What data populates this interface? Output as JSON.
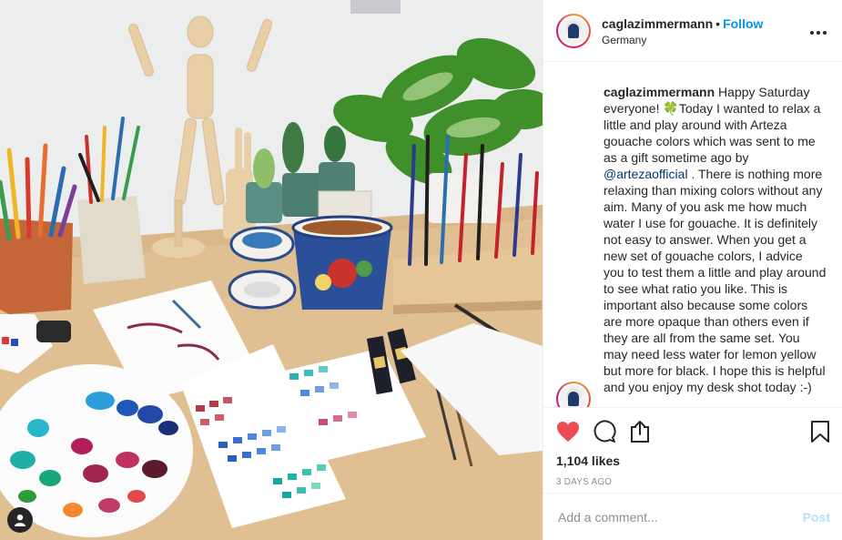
{
  "post": {
    "username": "caglazimmermann",
    "separator": "•",
    "follow_label": "Follow",
    "location": "Germany",
    "more_icon": "more-options-icon",
    "caption": {
      "username": "caglazimmermann",
      "text_before_emoji": " Happy Saturday everyone! ",
      "emoji": "🍀",
      "text_before_mention": "Today I wanted to relax a little and play around with Arteza gouache colors which was sent to me as a gift sometime ago by ",
      "mention": "@artezaofficial",
      "text_after_mention": " . There is nothing more relaxing than mixing colors without any aim. Many of you ask me how much water I use for gouache. It is definitely not easy to answer. When you get a new set of gouache colors, I advice you to test them a little and play around to see what ratio you like. This is important also because some colors are more opaque than others even if they are all from the same set. You may need less water for lemon yellow but more for black. I hope this is helpful and you enjoy my desk shot today :-)"
    },
    "likes": "1,104 likes",
    "timestamp": "3 DAYS AGO",
    "comment_placeholder": "Add a comment...",
    "post_label": "Post",
    "colors": {
      "like_red": "#ed4956",
      "follow_blue": "#0095f6",
      "mention_blue": "#00376b",
      "post_disabled": "#b2dffc",
      "meta_gray": "#8e8e8e"
    },
    "icons": [
      "heart-icon",
      "comment-icon",
      "share-icon",
      "bookmark-icon",
      "user-tag-icon"
    ]
  }
}
